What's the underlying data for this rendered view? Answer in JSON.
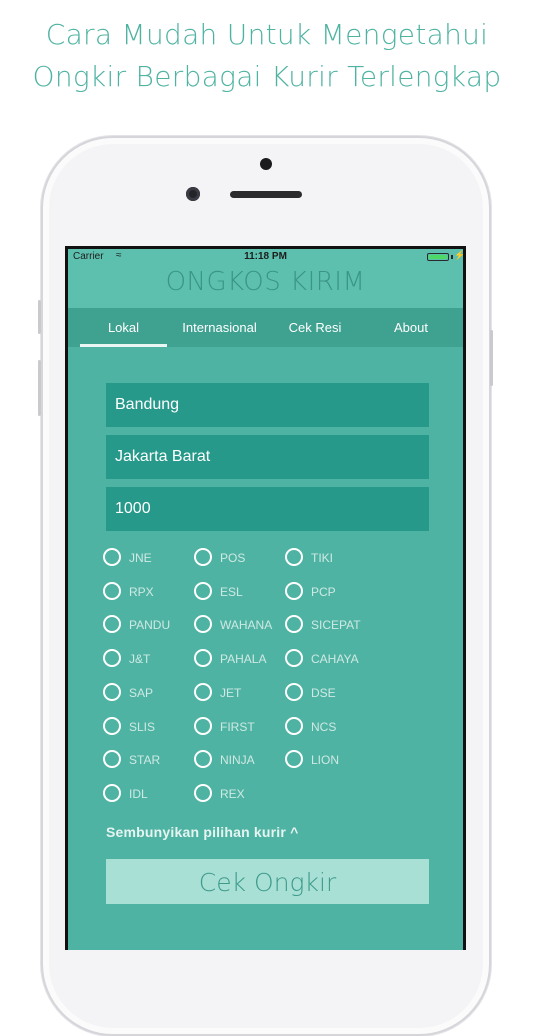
{
  "headline": {
    "line1": "Cara Mudah Untuk Mengetahui",
    "line2": "Ongkir Berbagai Kurir Terlengkap"
  },
  "status_bar": {
    "carrier": "Carrier",
    "wifi_icon": "wifi-icon",
    "time": "11:18 PM",
    "battery_icon": "battery-icon"
  },
  "app": {
    "title": "ONGKOS KIRIM"
  },
  "tabs": [
    {
      "label": "Lokal",
      "selected": true
    },
    {
      "label": "Internasional",
      "selected": false
    },
    {
      "label": "Cek Resi",
      "selected": false
    },
    {
      "label": "About",
      "selected": false
    }
  ],
  "form": {
    "origin": "Bandung",
    "destination": "Jakarta Barat",
    "weight": "1000"
  },
  "couriers": [
    [
      "JNE",
      "POS",
      "TIKI"
    ],
    [
      "RPX",
      "ESL",
      "PCP"
    ],
    [
      "PANDU",
      "WAHANA",
      "SICEPAT"
    ],
    [
      "J&T",
      "PAHALA",
      "CAHAYA"
    ],
    [
      "SAP",
      "JET",
      "DSE"
    ],
    [
      "SLIS",
      "FIRST",
      "NCS"
    ],
    [
      "STAR",
      "NINJA",
      "LION"
    ],
    [
      "IDL",
      "REX"
    ]
  ],
  "hide_courier_label": "Sembunyikan pilihan kurir ^",
  "submit_label": "Cek Ongkir",
  "colors": {
    "headline": "#4fb3a2",
    "background": "#4fb3a3",
    "tabbar": "#3fa190",
    "field": "#26998a",
    "button": "#a8e0d6"
  }
}
